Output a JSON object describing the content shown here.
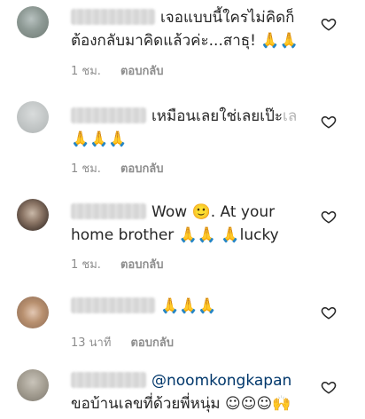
{
  "comments": [
    {
      "line1": "เจอแบบนี้ใครไม่คิดก็",
      "line2": "ต้องกลับมาคิดแล้วค่ะ...สาธุ! 🙏🙏",
      "time": "1 ชม.",
      "reply": "ตอบกลับ"
    },
    {
      "line1": "เหมือนเลยใช่เลยเป๊ะ",
      "line1_fade": "เล",
      "line2": "🙏🙏🙏",
      "time": "1 ชม.",
      "reply": "ตอบกลับ"
    },
    {
      "line1": "Wow 🙂. At your",
      "line2": "home brother 🙏🙏 🙏lucky",
      "time": "1 ชม.",
      "reply": "ตอบกลับ"
    },
    {
      "line1": "🙏🙏🙏",
      "time": "13 นาที",
      "reply": "ตอบกลับ"
    },
    {
      "mention": "@noomkongkapan",
      "line2": "ขอบ้านเลขที่ด้วยพี่หนุ่ม ☺☺☺🙌"
    }
  ],
  "icons": {
    "like": "heart-outline-icon"
  },
  "colors": {
    "text": "#262626",
    "meta": "#8e8e8e",
    "mention": "#00376b"
  }
}
